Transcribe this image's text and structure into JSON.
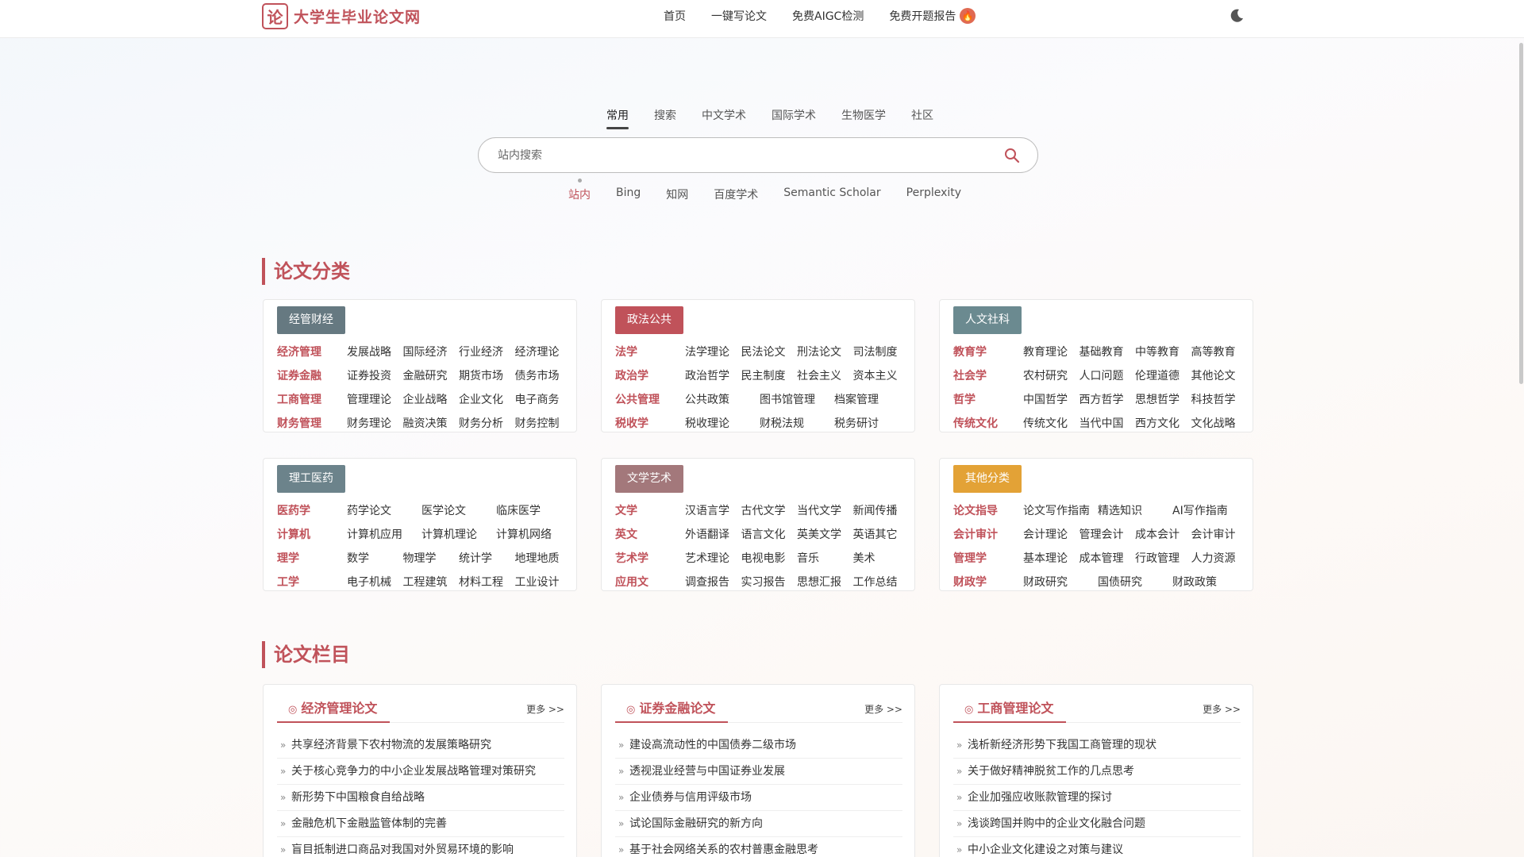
{
  "header": {
    "logo_char": "论",
    "site_title": "大学生毕业论文网",
    "nav": [
      {
        "label": "首页"
      },
      {
        "label": "一键写论文"
      },
      {
        "label": "免费AIGC检测"
      },
      {
        "label": "免费开题报告"
      }
    ],
    "theme_icon": "moon-icon"
  },
  "search": {
    "tabs": [
      "常用",
      "搜索",
      "中文学术",
      "国际学术",
      "生物医学",
      "社区"
    ],
    "active_tab": "常用",
    "placeholder": "站内搜索",
    "engines": [
      "站内",
      "Bing",
      "知网",
      "百度学术",
      "Semantic Scholar",
      "Perplexity"
    ],
    "active_engine": "站内"
  },
  "categories": {
    "title": "论文分类",
    "cards": [
      {
        "badge": "经管财经",
        "badge_color": "#667981",
        "rows": [
          {
            "head": "经济管理",
            "items": [
              "发展战略",
              "国际经济",
              "行业经济",
              "经济理论"
            ]
          },
          {
            "head": "证券金融",
            "items": [
              "证券投资",
              "金融研究",
              "期货市场",
              "债务市场"
            ]
          },
          {
            "head": "工商管理",
            "items": [
              "管理理论",
              "企业战略",
              "企业文化",
              "电子商务"
            ]
          },
          {
            "head": "财务管理",
            "items": [
              "财务理论",
              "融资决策",
              "财务分析",
              "财务控制"
            ]
          }
        ]
      },
      {
        "badge": "政法公共",
        "badge_color": "#c0525a",
        "rows": [
          {
            "head": "法学",
            "items": [
              "法学理论",
              "民法论文",
              "刑法论文",
              "司法制度"
            ]
          },
          {
            "head": "政治学",
            "items": [
              "政治哲学",
              "民主制度",
              "社会主义",
              "资本主义"
            ]
          },
          {
            "head": "公共管理",
            "items": [
              "公共政策",
              "图书馆管理",
              "档案管理"
            ]
          },
          {
            "head": "税收学",
            "items": [
              "税收理论",
              "财税法规",
              "税务研讨"
            ]
          }
        ]
      },
      {
        "badge": "人文社科",
        "badge_color": "#6b8a90",
        "rows": [
          {
            "head": "教育学",
            "items": [
              "教育理论",
              "基础教育",
              "中等教育",
              "高等教育"
            ]
          },
          {
            "head": "社会学",
            "items": [
              "农村研究",
              "人口问题",
              "伦理道德",
              "其他论文"
            ]
          },
          {
            "head": "哲学",
            "items": [
              "中国哲学",
              "西方哲学",
              "思想哲学",
              "科技哲学"
            ]
          },
          {
            "head": "传统文化",
            "items": [
              "传统文化",
              "当代中国",
              "西方文化",
              "文化战略"
            ]
          }
        ]
      },
      {
        "badge": "理工医药",
        "badge_color": "#6c838b",
        "rows": [
          {
            "head": "医药学",
            "items": [
              "药学论文",
              "医学论文",
              "临床医学"
            ]
          },
          {
            "head": "计算机",
            "items": [
              "计算机应用",
              "计算机理论",
              "计算机网络"
            ]
          },
          {
            "head": "理学",
            "items": [
              "数学",
              "物理学",
              "统计学",
              "地理地质"
            ]
          },
          {
            "head": "工学",
            "items": [
              "电子机械",
              "工程建筑",
              "材料工程",
              "工业设计"
            ]
          }
        ]
      },
      {
        "badge": "文学艺术",
        "badge_color": "#a3787b",
        "rows": [
          {
            "head": "文学",
            "items": [
              "汉语言学",
              "古代文学",
              "当代文学",
              "新闻传播"
            ]
          },
          {
            "head": "英文",
            "items": [
              "外语翻译",
              "语言文化",
              "英美文学",
              "英语其它"
            ]
          },
          {
            "head": "艺术学",
            "items": [
              "艺术理论",
              "电视电影",
              "音乐",
              "美术"
            ]
          },
          {
            "head": "应用文",
            "items": [
              "调查报告",
              "实习报告",
              "思想汇报",
              "工作总结"
            ]
          }
        ]
      },
      {
        "badge": "其他分类",
        "badge_color": "#e3a236",
        "rows": [
          {
            "head": "论文指导",
            "items": [
              "论文写作指南",
              "精选知识",
              "AI写作指南"
            ]
          },
          {
            "head": "会计审计",
            "items": [
              "会计理论",
              "管理会计",
              "成本会计",
              "会计审计"
            ]
          },
          {
            "head": "管理学",
            "items": [
              "基本理论",
              "成本管理",
              "行政管理",
              "人力资源"
            ]
          },
          {
            "head": "财政学",
            "items": [
              "财政研究",
              "国债研究",
              "财政政策"
            ]
          }
        ]
      }
    ]
  },
  "columns": {
    "title": "论文栏目",
    "more_label": "更多 >>",
    "cards": [
      {
        "title": "经济管理论文",
        "articles": [
          "共享经济背景下农村物流的发展策略研究",
          "关于核心竞争力的中小企业发展战略管理对策研究",
          "新形势下中国粮食自给战略",
          "金融危机下金融监管体制的完善",
          "盲目抵制进口商品对我国对外贸易环境的影响"
        ]
      },
      {
        "title": "证券金融论文",
        "articles": [
          "建设高流动性的中国债券二级市场",
          "透视混业经营与中国证券业发展",
          "企业债券与信用评级市场",
          "试论国际金融研究的新方向",
          "基于社会网络关系的农村普惠金融思考"
        ]
      },
      {
        "title": "工商管理论文",
        "articles": [
          "浅析新经济形势下我国工商管理的现状",
          "关于做好精神脱贫工作的几点思考",
          "企业加强应收账款管理的探讨",
          "浅谈跨国并购中的企业文化融合问题",
          "中小企业文化建设之对策与建议"
        ]
      }
    ]
  }
}
